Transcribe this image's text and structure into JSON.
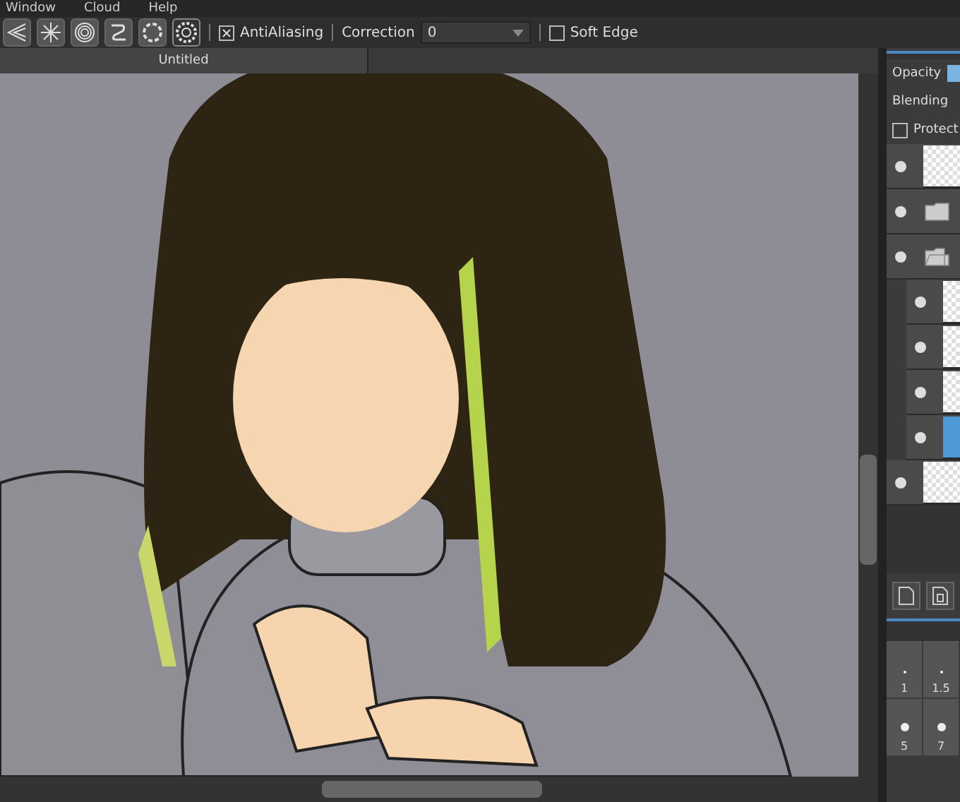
{
  "menu": [
    "Window",
    "Cloud",
    "Help"
  ],
  "toolbar": {
    "tools": [
      {
        "selected": false
      },
      {
        "selected": false
      },
      {
        "selected": false
      },
      {
        "selected": false
      },
      {
        "selected": false
      },
      {
        "selected": true
      }
    ],
    "antialiasing": {
      "label": "AntiAliasing",
      "checked": true
    },
    "correction": {
      "label": "Correction",
      "value": "0"
    },
    "soft_edge": {
      "label": "Soft Edge",
      "checked": false
    }
  },
  "document_tab": {
    "title": "Untitled"
  },
  "layer_panel": {
    "opacity_label": "Opacity",
    "opacity": {
      "level": 1
    },
    "blending_label": "Blending",
    "protect": {
      "label": "Protect",
      "checked": false
    },
    "layers": [
      {
        "kind": "layer",
        "visible": true,
        "selected": false
      },
      {
        "kind": "folder",
        "visible": true,
        "selected": false,
        "expanded": false
      },
      {
        "kind": "folder",
        "visible": true,
        "selected": false,
        "expanded": true,
        "children": [
          {
            "kind": "layer",
            "visible": true,
            "selected": false
          },
          {
            "kind": "layer",
            "visible": true,
            "selected": false
          },
          {
            "kind": "layer",
            "visible": true,
            "selected": false
          },
          {
            "kind": "layer",
            "visible": true,
            "selected": true
          }
        ]
      },
      {
        "kind": "layer",
        "visible": true,
        "selected": false
      }
    ]
  },
  "brush_sizes": [
    {
      "label": "1",
      "selected": false
    },
    {
      "label": "1.5",
      "selected": false
    },
    {
      "label": "5",
      "selected": false
    },
    {
      "label": "7",
      "selected": false
    }
  ]
}
